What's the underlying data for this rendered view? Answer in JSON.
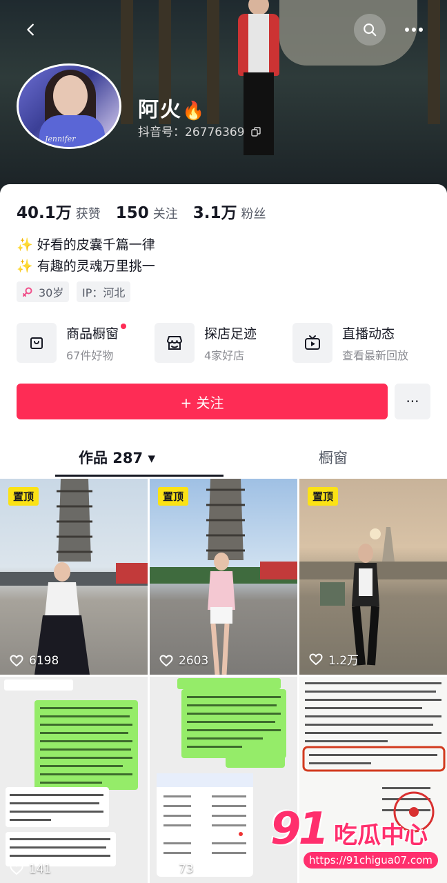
{
  "profile": {
    "nickname": "阿火",
    "nickname_emoji": "🔥",
    "douyin_id": "抖音号：26776369"
  },
  "stats": [
    {
      "value": "40.1万",
      "label": "获赞"
    },
    {
      "value": "150",
      "label": "关注"
    },
    {
      "value": "3.1万",
      "label": "粉丝"
    }
  ],
  "bio": {
    "line1": "✨ 好看的皮囊千篇一律",
    "line2": "✨ 有趣的灵魂万里挑一"
  },
  "tags": {
    "age": "30岁",
    "ip": "IP：河北"
  },
  "features": [
    {
      "title": "商品橱窗",
      "sub": "67件好物",
      "icon": "shop-bag-icon"
    },
    {
      "title": "探店足迹",
      "sub": "4家好店",
      "icon": "store-icon"
    },
    {
      "title": "直播动态",
      "sub": "查看最新回放",
      "icon": "live-tv-icon"
    }
  ],
  "actions": {
    "follow": "+ 关注",
    "more": "···"
  },
  "tabs": {
    "works": "作品 287 ▾",
    "showcase": "橱窗"
  },
  "posts": [
    {
      "pinned": "置顶",
      "likes": "6198"
    },
    {
      "pinned": "置顶",
      "likes": "2603"
    },
    {
      "pinned": "置顶",
      "likes": "1.2万"
    },
    {
      "likes": "141"
    },
    {
      "likes": "73"
    }
  ],
  "watermark": {
    "number": "91",
    "title": "吃瓜中心",
    "url": "https://91chigua07.com"
  },
  "colors": {
    "accent": "#fe2c55",
    "pin": "#fbe216"
  }
}
